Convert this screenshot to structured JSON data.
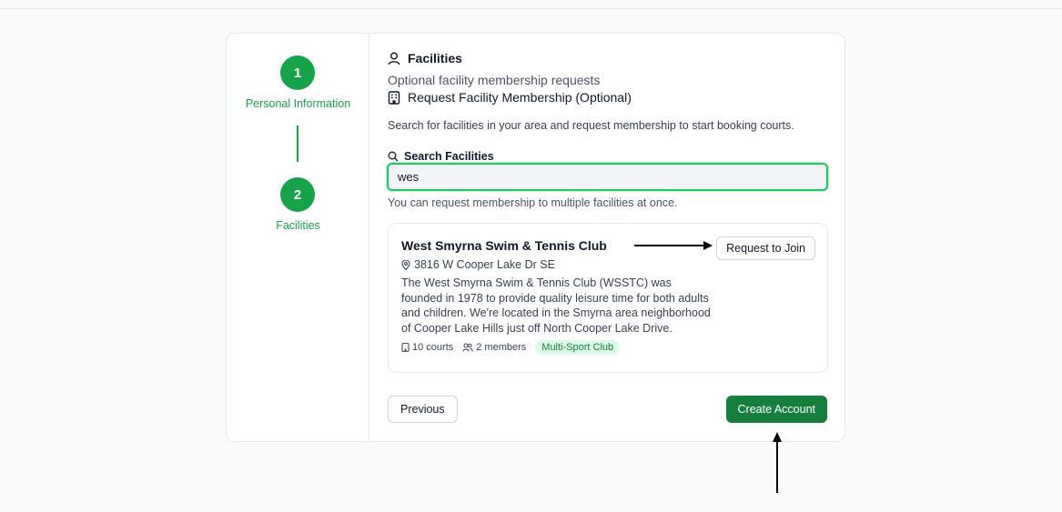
{
  "steps": [
    {
      "number": "1",
      "label": "Personal Information"
    },
    {
      "number": "2",
      "label": "Facilities"
    }
  ],
  "section": {
    "title": "Facilities",
    "subtitle": "Optional facility membership requests",
    "request_heading": "Request Facility Membership (Optional)",
    "description": "Search for facilities in your area and request membership to start booking courts."
  },
  "search": {
    "label": "Search Facilities",
    "value": "wes",
    "helper": "You can request membership to multiple facilities at once."
  },
  "facility": {
    "name": "West Smyrna Swim & Tennis Club",
    "address": "3816 W Cooper Lake Dr SE",
    "description": "The West Smyrna Swim & Tennis Club (WSSTC) was founded in 1978 to provide quality leisure time for both adults and children. We're located in the Smyrna area neighborhood of Cooper Lake Hills just off North Cooper Lake Drive.",
    "courts": "10 courts",
    "members": "2 members",
    "badge": "Multi-Sport Club",
    "join_label": "Request to Join"
  },
  "footer": {
    "previous_label": "Previous",
    "create_label": "Create Account"
  },
  "colors": {
    "accent": "#16a34a",
    "primary_button": "#15803d",
    "badge_bg": "#dcfce7"
  }
}
